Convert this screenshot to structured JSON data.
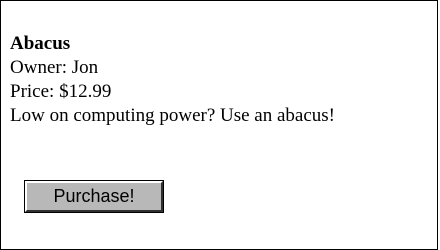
{
  "product": {
    "name": "Abacus",
    "owner": "Owner: Jon",
    "price": "Price: $12.99",
    "description": "Low on computing power? Use an abacus!"
  },
  "actions": {
    "purchase_label": "Purchase!"
  }
}
